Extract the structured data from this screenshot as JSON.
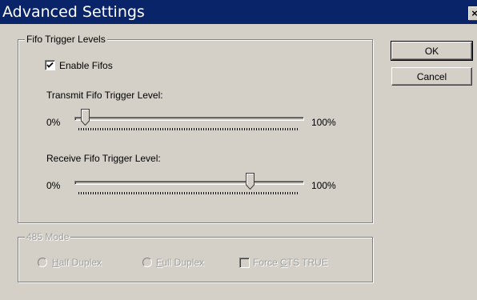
{
  "window": {
    "title": "Advanced Settings",
    "close_glyph": "×"
  },
  "fifo_group": {
    "label": "Fifo Trigger Levels",
    "enable_checkbox": {
      "label": "Enable Fifos",
      "checked": true
    },
    "transmit": {
      "label": "Transmit Fifo Trigger Level:",
      "min_label": "0%",
      "max_label": "100%",
      "value_percent": 3
    },
    "receive": {
      "label": "Receive Fifo Trigger Level:",
      "min_label": "0%",
      "max_label": "100%",
      "value_percent": 78
    }
  },
  "buttons": {
    "ok": "OK",
    "cancel": "Cancel"
  },
  "mode_group": {
    "label": "485 Mode",
    "half_duplex": {
      "mnemonic": "H",
      "rest": "alf Duplex",
      "selected": false
    },
    "full_duplex": {
      "mnemonic": "F",
      "rest": "ull Duplex",
      "selected": false
    },
    "force_cts": {
      "before": "Force ",
      "mnemonic": "C",
      "rest": "TS TRUE",
      "checked": false
    }
  },
  "colors": {
    "titlebar": "#0a246a",
    "face": "#d4d0c8",
    "disabled_text": "#a0a0a0"
  }
}
